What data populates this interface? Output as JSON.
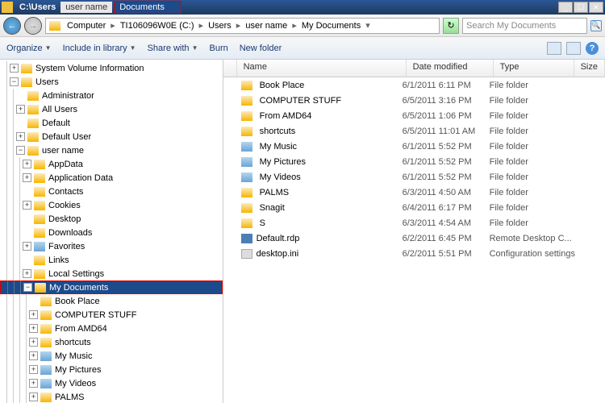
{
  "titlebar": {
    "path": "C:\\Users",
    "user": "user name",
    "doc": "Documents",
    "min": "_",
    "max": "☐",
    "close": "✕"
  },
  "nav": {
    "back": "←",
    "fwd": "→"
  },
  "breadcrumb": {
    "items": [
      "Computer",
      "TI106096W0E (C:)",
      "Users",
      "user name",
      "My Documents"
    ],
    "refresh": "↻"
  },
  "search": {
    "placeholder": "Search My Documents",
    "icon": "🔍"
  },
  "toolbar": {
    "organize": "Organize",
    "include": "Include in library",
    "share": "Share with",
    "burn": "Burn",
    "newfolder": "New folder",
    "help": "?"
  },
  "columns": {
    "name": "Name",
    "date": "Date modified",
    "type": "Type",
    "size": "Size"
  },
  "tree": [
    {
      "lvl": 1,
      "exp": "+",
      "icon": "f",
      "label": "System Volume Information"
    },
    {
      "lvl": 1,
      "exp": "-",
      "icon": "f",
      "label": "Users"
    },
    {
      "lvl": 2,
      "exp": "",
      "icon": "f",
      "label": "Administrator"
    },
    {
      "lvl": 2,
      "exp": "+",
      "icon": "f",
      "label": "All Users"
    },
    {
      "lvl": 2,
      "exp": "",
      "icon": "f",
      "label": "Default"
    },
    {
      "lvl": 2,
      "exp": "+",
      "icon": "f",
      "label": "Default User"
    },
    {
      "lvl": 2,
      "exp": "-",
      "icon": "f",
      "label": "user name"
    },
    {
      "lvl": 3,
      "exp": "+",
      "icon": "f",
      "label": "AppData"
    },
    {
      "lvl": 3,
      "exp": "+",
      "icon": "f",
      "label": "Application Data"
    },
    {
      "lvl": 3,
      "exp": "",
      "icon": "f",
      "label": "Contacts"
    },
    {
      "lvl": 3,
      "exp": "+",
      "icon": "f",
      "label": "Cookies"
    },
    {
      "lvl": 3,
      "exp": "",
      "icon": "f",
      "label": "Desktop"
    },
    {
      "lvl": 3,
      "exp": "",
      "icon": "f",
      "label": "Downloads"
    },
    {
      "lvl": 3,
      "exp": "+",
      "icon": "s",
      "label": "Favorites"
    },
    {
      "lvl": 3,
      "exp": "",
      "icon": "f",
      "label": "Links"
    },
    {
      "lvl": 3,
      "exp": "+",
      "icon": "f",
      "label": "Local Settings"
    },
    {
      "lvl": 3,
      "exp": "-",
      "icon": "f",
      "label": "My Documents",
      "sel": true,
      "hl": true
    },
    {
      "lvl": 4,
      "exp": "",
      "icon": "f",
      "label": "Book Place"
    },
    {
      "lvl": 4,
      "exp": "+",
      "icon": "f",
      "label": "COMPUTER STUFF"
    },
    {
      "lvl": 4,
      "exp": "+",
      "icon": "f",
      "label": "From AMD64"
    },
    {
      "lvl": 4,
      "exp": "+",
      "icon": "f",
      "label": "shortcuts"
    },
    {
      "lvl": 4,
      "exp": "+",
      "icon": "s",
      "label": "My Music"
    },
    {
      "lvl": 4,
      "exp": "+",
      "icon": "s",
      "label": "My Pictures"
    },
    {
      "lvl": 4,
      "exp": "+",
      "icon": "s",
      "label": "My Videos"
    },
    {
      "lvl": 4,
      "exp": "+",
      "icon": "f",
      "label": "PALMS"
    }
  ],
  "files": [
    {
      "icon": "f",
      "name": "Book Place",
      "date": "6/1/2011 6:11 PM",
      "type": "File folder"
    },
    {
      "icon": "f",
      "name": "COMPUTER STUFF",
      "date": "6/5/2011 3:16 PM",
      "type": "File folder"
    },
    {
      "icon": "f",
      "name": "From AMD64",
      "date": "6/5/2011 1:06 PM",
      "type": "File folder"
    },
    {
      "icon": "f",
      "name": "shortcuts",
      "date": "6/5/2011 11:01 AM",
      "type": "File folder"
    },
    {
      "icon": "s",
      "name": "My Music",
      "date": "6/1/2011 5:52 PM",
      "type": "File folder"
    },
    {
      "icon": "s",
      "name": "My Pictures",
      "date": "6/1/2011 5:52 PM",
      "type": "File folder"
    },
    {
      "icon": "s",
      "name": "My Videos",
      "date": "6/1/2011 5:52 PM",
      "type": "File folder"
    },
    {
      "icon": "f",
      "name": "PALMS",
      "date": "6/3/2011 4:50 AM",
      "type": "File folder"
    },
    {
      "icon": "f",
      "name": "Snagit",
      "date": "6/4/2011 6:17 PM",
      "type": "File folder"
    },
    {
      "icon": "f",
      "name": "S",
      "date": "6/3/2011 4:54 AM",
      "type": "File folder"
    },
    {
      "icon": "r",
      "name": "Default.rdp",
      "date": "6/2/2011 6:45 PM",
      "type": "Remote Desktop C..."
    },
    {
      "icon": "i",
      "name": "desktop.ini",
      "date": "6/2/2011 5:51 PM",
      "type": "Configuration settings"
    }
  ]
}
